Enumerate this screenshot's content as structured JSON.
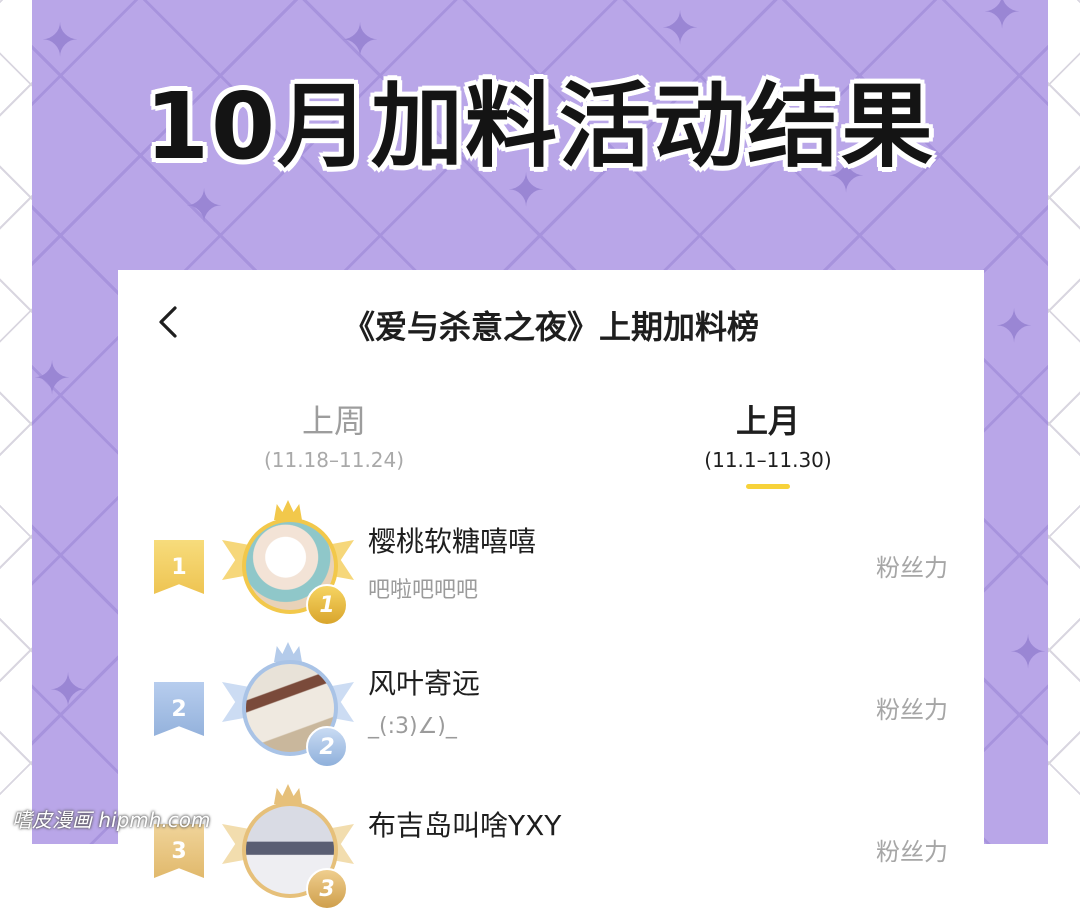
{
  "poster": {
    "headline": "10月加料活动结果"
  },
  "screen": {
    "title": "《爱与杀意之夜》上期加料榜",
    "back_icon": "chevron-left-icon",
    "tabs": [
      {
        "label": "上周",
        "range": "(11.18–11.24)",
        "active": false
      },
      {
        "label": "上月",
        "range": "(11.1–11.30)",
        "active": true
      }
    ],
    "ranking": [
      {
        "rank": "1",
        "name": "樱桃软糖嘻嘻",
        "subtitle": "吧啦吧吧吧",
        "metric": "粉丝力",
        "medal": "1"
      },
      {
        "rank": "2",
        "name": "风叶寄远",
        "subtitle": "_(:3)∠)_",
        "metric": "粉丝力",
        "medal": "2"
      },
      {
        "rank": "3",
        "name": "布吉岛叫啥YXY",
        "subtitle": "",
        "metric": "粉丝力",
        "medal": "3"
      }
    ]
  },
  "watermark": "嗜皮漫画 hipmh.com",
  "colors": {
    "poster_purple": "#b9a6e8",
    "active_tab_underline": "#f7d23a",
    "gold": "#f2c84b",
    "silver_blue": "#a9c3e6",
    "bronze": "#e6c07a"
  }
}
